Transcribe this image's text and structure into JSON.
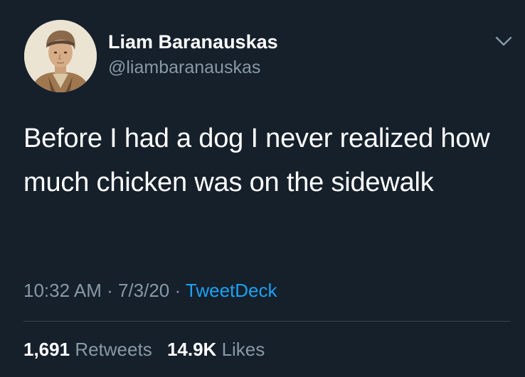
{
  "user": {
    "display_name": "Liam Baranauskas",
    "handle": "@liambaranauskas",
    "avatar_icon": "portrait-avatar"
  },
  "menu_icon": "chevron-down-icon",
  "tweet": {
    "text": "Before I had a dog I never realized how much chicken was on the sidewalk"
  },
  "meta": {
    "time": "10:32 AM",
    "separator1": " · ",
    "date": "7/3/20",
    "separator2": " · ",
    "source": "TweetDeck"
  },
  "stats": {
    "retweets_count": "1,691",
    "retweets_label": "Retweets",
    "likes_count": "14.9K",
    "likes_label": "Likes"
  },
  "colors": {
    "background": "#15202b",
    "primary_text": "#ffffff",
    "secondary_text": "#8899a6",
    "link": "#1da1f2",
    "divider": "#38444d"
  }
}
